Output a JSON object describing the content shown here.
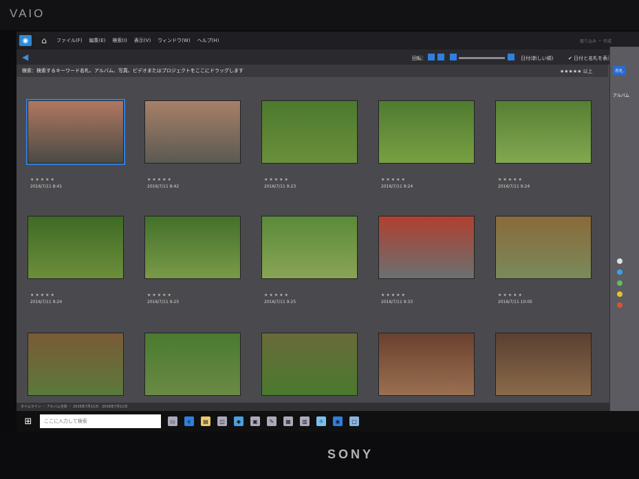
{
  "device": {
    "top_brand": "VAIO",
    "bottom_brand": "SONY"
  },
  "menu": {
    "items": [
      "ファイル(F)",
      "編集(E)",
      "検索(I)",
      "表示(V)",
      "ウィンドウ(W)",
      "ヘルプ(H)"
    ],
    "right": "取り込み ・ 作成"
  },
  "search": {
    "text": "検索：検索するキーワード名札、アルバム、写真、ビデオまたはプロジェクトをここにドラッグします"
  },
  "view_controls": {
    "rotate_label": "回転：",
    "sort_label": "日付(新しい順)",
    "show_dates_label": "✔ 日付と名札を表示",
    "rating_filter": "★★★★★  以上"
  },
  "thumbnails": [
    {
      "date": "2016/7/11 8:41",
      "stars": "★★★★★",
      "colors": [
        "#b07860",
        "#4a4a46"
      ],
      "selected": true
    },
    {
      "date": "2016/7/11 8:42",
      "stars": "★★★★★",
      "colors": [
        "#a87f68",
        "#5a5a52"
      ],
      "selected": false
    },
    {
      "date": "2016/7/11 9:23",
      "stars": "★★★★★",
      "colors": [
        "#4d7a2e",
        "#6a8f3c"
      ],
      "selected": false
    },
    {
      "date": "2016/7/11 9:24",
      "stars": "★★★★★",
      "colors": [
        "#4f7b30",
        "#78a043"
      ],
      "selected": false
    },
    {
      "date": "2016/7/11 9:24",
      "stars": "★★★★★",
      "colors": [
        "#567f34",
        "#82a850"
      ],
      "selected": false
    },
    {
      "date": "2016/7/11 9:24",
      "stars": "★★★★★",
      "colors": [
        "#3f6a26",
        "#6c8e3a"
      ],
      "selected": false
    },
    {
      "date": "2016/7/11 9:25",
      "stars": "★★★★★",
      "colors": [
        "#43702a",
        "#7a9a48"
      ],
      "selected": false
    },
    {
      "date": "2016/7/11 9:25",
      "stars": "★★★★★",
      "colors": [
        "#5a8a3a",
        "#8aa456"
      ],
      "selected": false
    },
    {
      "date": "2016/7/11 9:33",
      "stars": "★★★★★",
      "colors": [
        "#b04030",
        "#6a7070"
      ],
      "selected": false
    },
    {
      "date": "2016/7/11 10:05",
      "stars": "★★★★★",
      "colors": [
        "#8a6a3a",
        "#7a8a5a"
      ],
      "selected": false
    },
    {
      "date": "",
      "stars": "",
      "colors": [
        "#7a5a38",
        "#5a7a3a"
      ],
      "selected": false
    },
    {
      "date": "",
      "stars": "",
      "colors": [
        "#4a7a30",
        "#6a8a44"
      ],
      "selected": false
    },
    {
      "date": "",
      "stars": "",
      "colors": [
        "#6a6a3a",
        "#4a7a2e"
      ],
      "selected": false
    },
    {
      "date": "",
      "stars": "",
      "colors": [
        "#6a4030",
        "#9a7050"
      ],
      "selected": false
    },
    {
      "date": "",
      "stars": "",
      "colors": [
        "#5a4030",
        "#8a6a4a"
      ],
      "selected": false
    }
  ],
  "side_panel": {
    "title": "名札",
    "album_label": "アルバム"
  },
  "status_bar": {
    "text": "タイムライン ・ アルバム全体 ・ 2016年7月11日 - 2016年7月11日"
  },
  "taskbar": {
    "search_placeholder": "ここに入力して検索"
  },
  "colors": {
    "accent": "#2f7fe0",
    "screen_bg": "#4a4a4e"
  }
}
